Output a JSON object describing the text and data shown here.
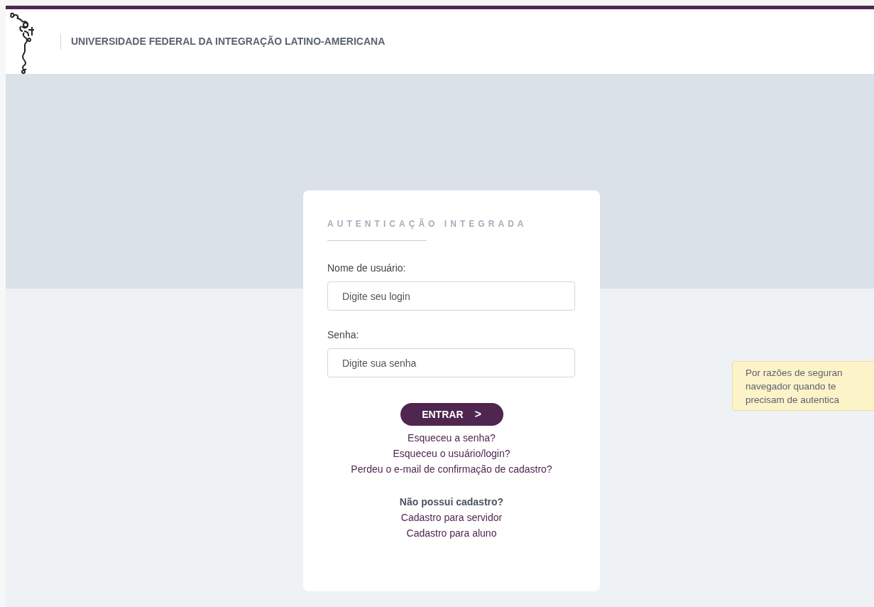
{
  "header": {
    "title": "UNIVERSIDADE FEDERAL DA INTEGRAÇÃO LATINO-AMERICANA"
  },
  "login": {
    "heading": "AUTENTICAÇÃO INTEGRADA",
    "fields": [
      {
        "label": "Nome de usuário:",
        "placeholder": "Digite seu login"
      },
      {
        "label": "Senha:",
        "placeholder": "Digite sua senha"
      }
    ],
    "submit": {
      "label": "ENTRAR",
      "arrow": ">"
    },
    "help_links": [
      "Esqueceu a senha?",
      "Esqueceu o usuário/login?",
      "Perdeu o e-mail de confirmação de cadastro?"
    ],
    "register_prompt": "Não possui cadastro?",
    "register_links": [
      "Cadastro para servidor",
      "Cadastro para aluno"
    ]
  },
  "notice": {
    "lines": [
      "Por razões de seguran",
      "navegador quando te",
      "precisam de autentica"
    ]
  }
}
